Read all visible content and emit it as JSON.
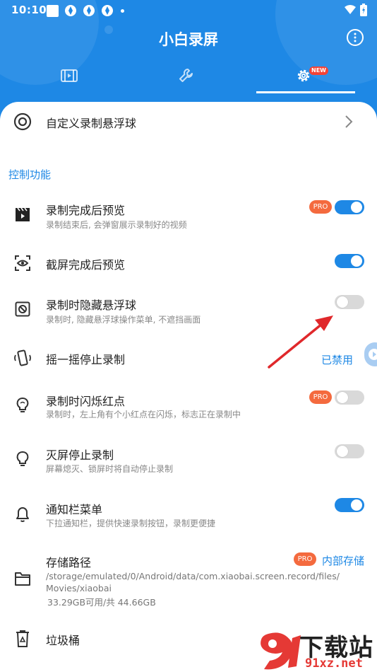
{
  "status_bar": {
    "time": "10:10"
  },
  "app": {
    "title": "小白录屏"
  },
  "tabs": {
    "new_badge": "NEW"
  },
  "top_item": {
    "label": "自定义录制悬浮球"
  },
  "section": {
    "title": "控制功能"
  },
  "settings": [
    {
      "title": "录制完成后预览",
      "subtitle": "录制结束后, 会弹窗展示录制好的视频",
      "pro": "PRO",
      "toggle": "on"
    },
    {
      "title": "截屏完成后预览",
      "toggle": "on"
    },
    {
      "title": "录制时隐藏悬浮球",
      "subtitle": "录制时, 隐藏悬浮球操作菜单, 不遮挡画面",
      "toggle": "off"
    },
    {
      "title": "摇一摇停止录制",
      "value": "已禁用"
    },
    {
      "title": "录制时闪烁红点",
      "subtitle": "录制时，左上角有个小红点在闪烁，标志正在录制中",
      "pro": "PRO",
      "toggle": "off"
    },
    {
      "title": "灭屏停止录制",
      "subtitle": "屏幕熄灭、锁屏时将自动停止录制",
      "toggle": "off"
    },
    {
      "title": "通知栏菜单",
      "subtitle": "下拉通知栏，提供快速录制按钮，录制更便捷",
      "toggle": "on"
    },
    {
      "title": "存储路径",
      "path_line1": "/storage/emulated/0/Android/data/com.xiaobai.screen.record/files/",
      "path_line2": "Movies/xiaobai",
      "storage": "33.29GB可用/共 44.66GB",
      "pro": "PRO",
      "value": "内部存储"
    },
    {
      "title": "垃圾桶"
    }
  ],
  "watermark": {
    "text": "下载站",
    "url": "91xz.net"
  },
  "colors": {
    "primary": "#1e88e5",
    "pro": "#f46a3e",
    "arrow": "#e0282b"
  }
}
